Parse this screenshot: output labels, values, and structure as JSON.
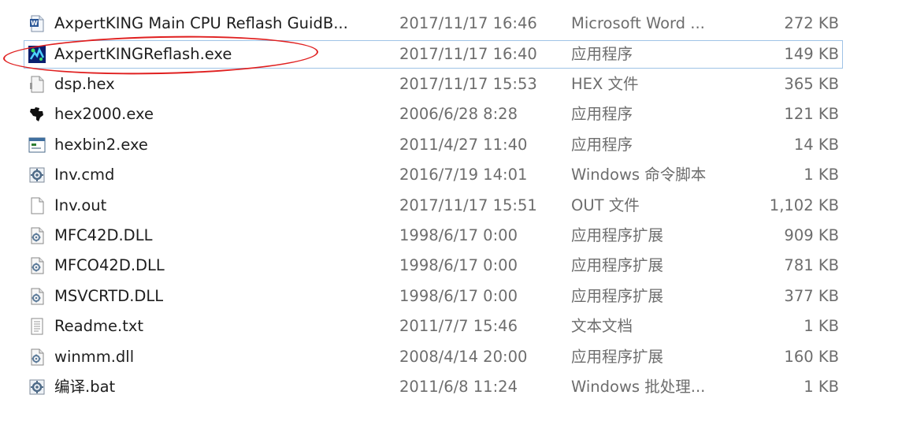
{
  "files": [
    {
      "name": "AxpertKING Main CPU Reflash GuidB...",
      "date": "2017/11/17 16:46",
      "type": "Microsoft Word ...",
      "size": "272 KB",
      "icon": "word-doc-icon"
    },
    {
      "name": "AxpertKINGReflash.exe",
      "date": "2017/11/17 16:40",
      "type": "应用程序",
      "size": "149 KB",
      "icon": "reflash-app-icon"
    },
    {
      "name": "dsp.hex",
      "date": "2017/11/17 15:53",
      "type": "HEX 文件",
      "size": "365 KB",
      "icon": "generic-file-icon"
    },
    {
      "name": "hex2000.exe",
      "date": "2006/6/28 8:28",
      "type": "应用程序",
      "size": "121 KB",
      "icon": "ti-logo-icon"
    },
    {
      "name": "hexbin2.exe",
      "date": "2011/4/27 11:40",
      "type": "应用程序",
      "size": "14 KB",
      "icon": "window-app-icon"
    },
    {
      "name": "Inv.cmd",
      "date": "2016/7/19 14:01",
      "type": "Windows 命令脚本",
      "size": "1 KB",
      "icon": "gear-script-icon"
    },
    {
      "name": "Inv.out",
      "date": "2017/11/17 15:51",
      "type": "OUT 文件",
      "size": "1,102 KB",
      "icon": "blank-file-icon"
    },
    {
      "name": "MFC42D.DLL",
      "date": "1998/6/17 0:00",
      "type": "应用程序扩展",
      "size": "909 KB",
      "icon": "dll-gear-icon"
    },
    {
      "name": "MFCO42D.DLL",
      "date": "1998/6/17 0:00",
      "type": "应用程序扩展",
      "size": "781 KB",
      "icon": "dll-gear-icon"
    },
    {
      "name": "MSVCRTD.DLL",
      "date": "1998/6/17 0:00",
      "type": "应用程序扩展",
      "size": "377 KB",
      "icon": "dll-gear-icon"
    },
    {
      "name": "Readme.txt",
      "date": "2011/7/7 15:46",
      "type": "文本文档",
      "size": "1 KB",
      "icon": "text-file-icon"
    },
    {
      "name": "winmm.dll",
      "date": "2008/4/14 20:00",
      "type": "应用程序扩展",
      "size": "160 KB",
      "icon": "dll-gear-icon"
    },
    {
      "name": "编译.bat",
      "date": "2011/6/8 11:24",
      "type": "Windows 批处理...",
      "size": "1 KB",
      "icon": "gear-script-icon"
    }
  ],
  "selected_index": 1,
  "colors": {
    "selection_border": "#9fc3e6",
    "annotation_red": "#e02020"
  }
}
